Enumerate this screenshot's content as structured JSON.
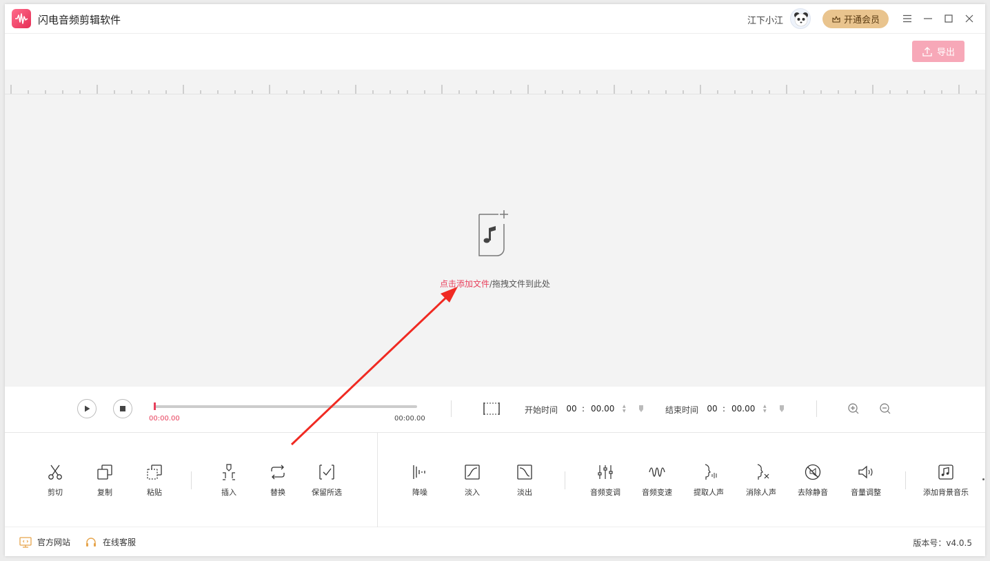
{
  "app": {
    "title": "闪电音频剪辑软件"
  },
  "user": {
    "name": "江下小江"
  },
  "header": {
    "vip_label": "开通会员",
    "export_label": "导出"
  },
  "drop_zone": {
    "link_text": "点击添加文件",
    "rest_text": "/拖拽文件到此处"
  },
  "player": {
    "current_time": "00:00.00",
    "total_time": "00:00.00",
    "start_label": "开始时间",
    "end_label": "结束时间",
    "start": {
      "hh": "00",
      "ss": "00.00"
    },
    "end": {
      "hh": "00",
      "ss": "00.00"
    }
  },
  "tools": {
    "cut": "剪切",
    "copy": "复制",
    "paste": "粘贴",
    "insert": "插入",
    "replace": "替换",
    "keep": "保留所选",
    "denoise": "降噪",
    "fade_in": "淡入",
    "fade_out": "淡出",
    "pitch": "音频变调",
    "speed": "音频变速",
    "extract_voice": "提取人声",
    "remove_voice": "消除人声",
    "remove_silence": "去除静音",
    "volume": "音量调整",
    "bgm": "添加背景音乐"
  },
  "status": {
    "website": "官方网站",
    "support": "在线客服",
    "version": "版本号：v4.0.5"
  },
  "colors": {
    "accent": "#e8405c",
    "export_button": "#f7a8b8",
    "vip_button": "#e9c48e",
    "editor_bg": "#f3f3f3",
    "annotation_arrow": "#f02a22"
  }
}
